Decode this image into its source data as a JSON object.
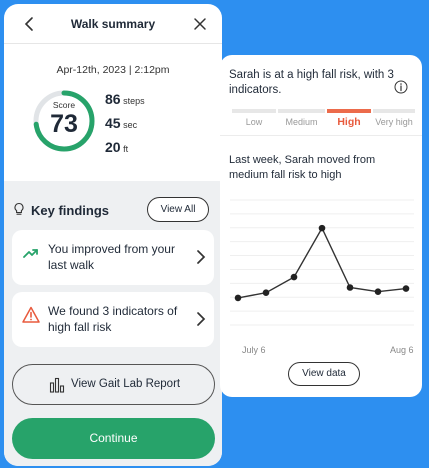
{
  "header": {
    "title": "Walk summary"
  },
  "summary": {
    "date": "Apr-12th, 2023 | 2:12pm",
    "score_label": "Score",
    "score_value": "73",
    "score_fraction": 0.73,
    "steps_value": "86",
    "steps_unit": "steps",
    "time_value": "45",
    "time_unit": "sec",
    "distance_value": "20",
    "distance_unit": "ft"
  },
  "findings": {
    "title": "Key findings",
    "view_all_label": "View All",
    "cards": [
      {
        "text": "You improved from your last walk",
        "icon": "trend-up-icon"
      },
      {
        "text": "We found 3 indicators of high fall risk",
        "icon": "warning-icon"
      }
    ]
  },
  "buttons": {
    "gait_report": "View Gait Lab Report",
    "continue": "Continue"
  },
  "risk": {
    "text": "Sarah is at a high fall risk, with 3 indicators.",
    "levels": [
      "Low",
      "Medium",
      "High",
      "Very high"
    ],
    "current": "High"
  },
  "trend": {
    "text": "Last week, Sarah moved from medium fall risk to high",
    "view_data_label": "View data"
  },
  "chart_data": {
    "type": "line",
    "x": [
      "July 6",
      "",
      "",
      "",
      "",
      "",
      "",
      "Aug 6"
    ],
    "series": [
      {
        "values": [
          2.6,
          3.1,
          4.6,
          9.3,
          3.6,
          3.2,
          3.5
        ]
      }
    ],
    "ylim": [
      0,
      12
    ],
    "x_tick_labels": [
      "July 6",
      "Aug 6"
    ],
    "grid": true
  },
  "colors": {
    "accent": "#27a36a",
    "risk": "#ec6b4b",
    "background": "#2d8ff0"
  }
}
